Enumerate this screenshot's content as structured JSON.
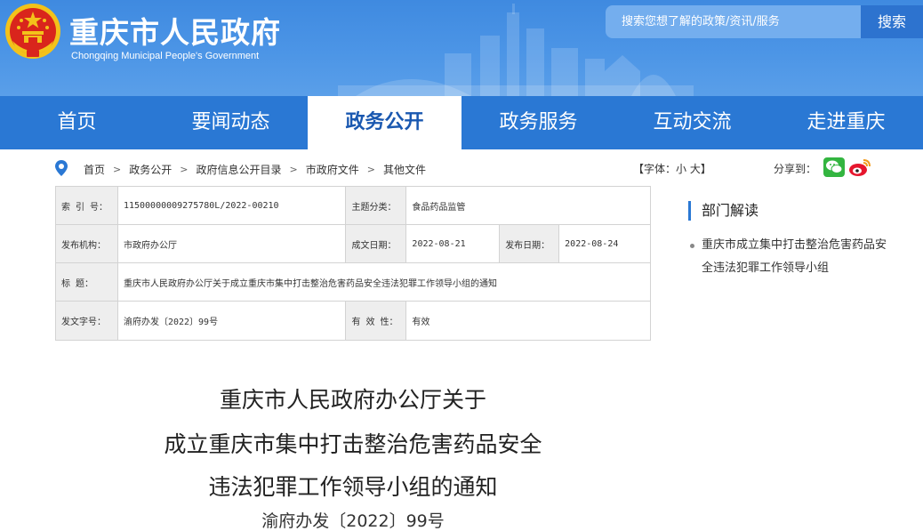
{
  "header": {
    "title": "重庆市人民政府",
    "subtitle": "Chongqing Municipal People's Government",
    "search_placeholder": "搜索您想了解的政策/资讯/服务",
    "search_button": "搜索"
  },
  "nav": {
    "items": [
      {
        "label": "首页",
        "active": false
      },
      {
        "label": "要闻动态",
        "active": false
      },
      {
        "label": "政务公开",
        "active": true
      },
      {
        "label": "政务服务",
        "active": false
      },
      {
        "label": "互动交流",
        "active": false
      },
      {
        "label": "走进重庆",
        "active": false
      }
    ]
  },
  "breadcrumb": {
    "items": [
      "首页",
      "政务公开",
      "政府信息公开目录",
      "市政府文件",
      "其他文件"
    ],
    "separator": ">"
  },
  "font_size_control": "【字体：小 大】",
  "share": {
    "label": "分享到："
  },
  "info": {
    "index_label": "索  引  号：",
    "index_value": "11500000009275780L/2022-00210",
    "topic_label": "主题分类：",
    "topic_value": "食品药品监管",
    "publisher_label": "发布机构：",
    "publisher_value": "市政府办公厅",
    "created_label": "成文日期：",
    "created_value": "2022-08-21",
    "published_label": "发布日期：",
    "published_value": "2022-08-24",
    "title_label": "标      题：",
    "title_value": "重庆市人民政府办公厅关于成立重庆市集中打击整治危害药品安全违法犯罪工作领导小组的通知",
    "docno_label": "发文字号：",
    "docno_value": "渝府办发〔2022〕99号",
    "validity_label": "有  效  性：",
    "validity_value": "有效"
  },
  "document": {
    "title_lines": [
      "重庆市人民政府办公厅关于",
      "成立重庆市集中打击整治危害药品安全",
      "违法犯罪工作领导小组的通知"
    ],
    "number": "渝府办发〔2022〕99号"
  },
  "sidebar": {
    "heading": "部门解读",
    "links": [
      "重庆市成立集中打击整治危害药品安全违法犯罪工作领导小组"
    ]
  },
  "colors": {
    "header_blue": "#4c95e6",
    "nav_blue": "#2a78d4",
    "search_button": "#2d73cf",
    "active_nav_text": "#1a58b0",
    "emblem_red": "#d9251c",
    "emblem_gold": "#f3c21a",
    "wechat_green": "#33b540",
    "weibo_red": "#e6162d"
  },
  "icons": [
    "national-emblem-icon",
    "location-pin-icon",
    "wechat-icon",
    "weibo-icon"
  ]
}
